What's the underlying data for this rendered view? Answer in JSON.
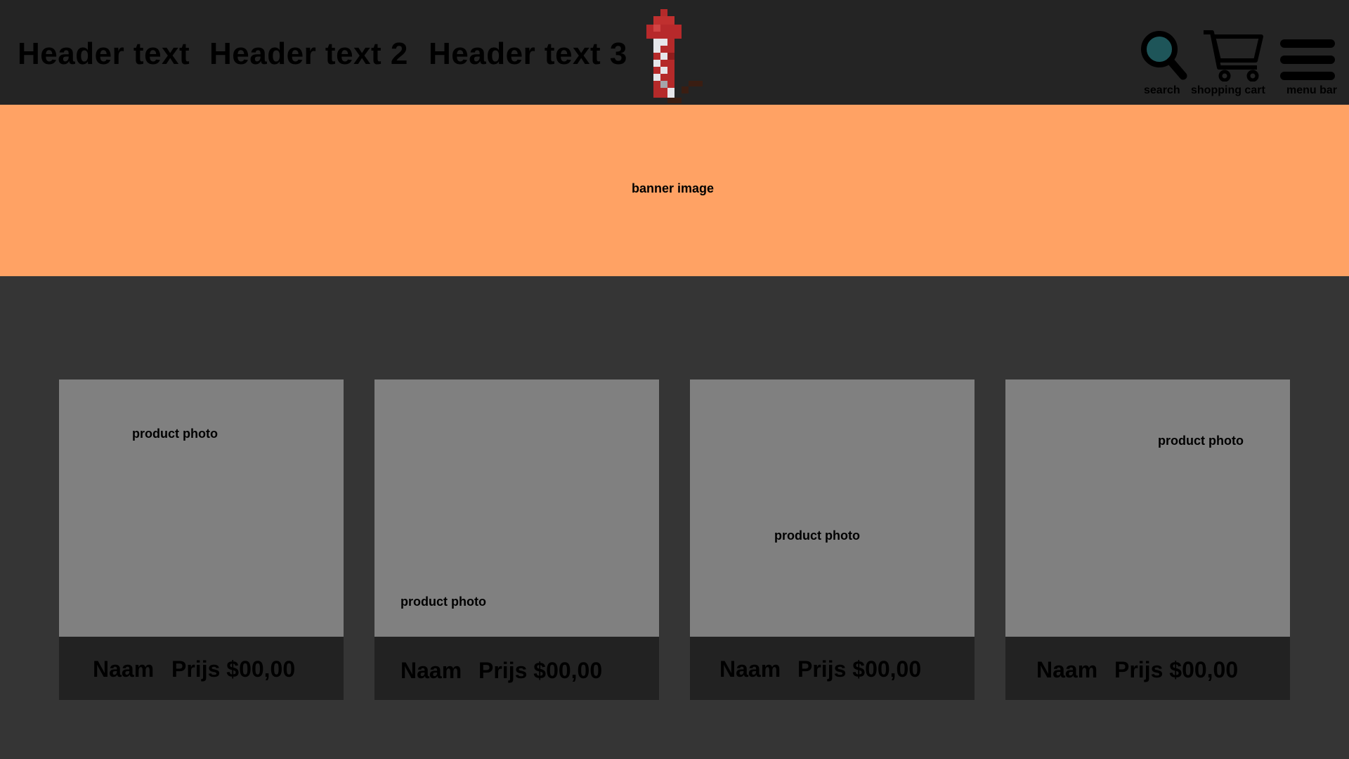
{
  "header": {
    "links": [
      "Header text",
      "Header text 2",
      "Header text 3"
    ],
    "icons": {
      "search_label": "search",
      "cart_label": "shopping cart",
      "menu_label": "menu bar"
    }
  },
  "banner": {
    "label": "banner image"
  },
  "products": [
    {
      "photo_label": "product photo",
      "name": "Naam",
      "price": "Prijs $00,00"
    },
    {
      "photo_label": "product photo",
      "name": "Naam",
      "price": "Prijs $00,00"
    },
    {
      "photo_label": "product photo",
      "name": "Naam",
      "price": "Prijs $00,00"
    },
    {
      "photo_label": "product photo",
      "name": "Naam",
      "price": "Prijs $00,00"
    }
  ],
  "colors": {
    "page_background": "#353535",
    "header_background": "#242424",
    "banner_background": "#ffa264",
    "photo_placeholder": "#808080",
    "card_info_background": "#222222"
  }
}
